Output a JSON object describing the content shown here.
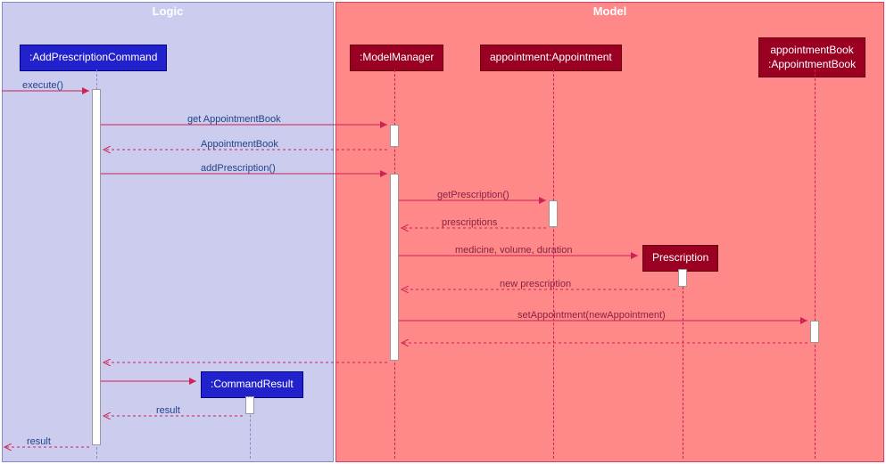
{
  "frames": {
    "logic": {
      "title": "Logic"
    },
    "model": {
      "title": "Model"
    }
  },
  "lifelines": {
    "addCmd": ":AddPrescriptionCommand",
    "modelMgr": ":ModelManager",
    "appointment": "appointment:Appointment",
    "apptBook": "appointmentBook\n:AppointmentBook",
    "prescription": "Prescription",
    "cmdResult": ":CommandResult"
  },
  "messages": {
    "execute": "execute()",
    "getApptBook": "get AppointmentBook",
    "apptBookRet": "AppointmentBook",
    "addPrescription": "addPrescription()",
    "getPrescription": "getPrescription()",
    "prescriptions": "prescriptions",
    "medVolDur": "medicine, volume, duration",
    "newPrescription": "new prescription",
    "setAppt": "setAppointment(newAppointment)",
    "resultInner": "result",
    "resultOuter": "result"
  },
  "chart_data": {
    "type": "sequence_diagram",
    "frames": [
      {
        "name": "Logic",
        "participants": [
          "AddPrescriptionCommand",
          "CommandResult"
        ]
      },
      {
        "name": "Model",
        "participants": [
          "ModelManager",
          "appointment:Appointment",
          "Prescription",
          "appointmentBook:AppointmentBook"
        ]
      }
    ],
    "participants": [
      {
        "id": "caller",
        "name": "(external)",
        "frame": null
      },
      {
        "id": "addCmd",
        "name": ":AddPrescriptionCommand",
        "frame": "Logic"
      },
      {
        "id": "modelMgr",
        "name": ":ModelManager",
        "frame": "Model"
      },
      {
        "id": "appointment",
        "name": "appointment:Appointment",
        "frame": "Model"
      },
      {
        "id": "prescription",
        "name": "Prescription",
        "frame": "Model",
        "created": true
      },
      {
        "id": "apptBook",
        "name": "appointmentBook:AppointmentBook",
        "frame": "Model"
      },
      {
        "id": "cmdResult",
        "name": ":CommandResult",
        "frame": "Logic",
        "created": true
      }
    ],
    "messages": [
      {
        "from": "caller",
        "to": "addCmd",
        "label": "execute()",
        "type": "sync"
      },
      {
        "from": "addCmd",
        "to": "modelMgr",
        "label": "get AppointmentBook",
        "type": "sync"
      },
      {
        "from": "modelMgr",
        "to": "addCmd",
        "label": "AppointmentBook",
        "type": "return"
      },
      {
        "from": "addCmd",
        "to": "modelMgr",
        "label": "addPrescription()",
        "type": "sync"
      },
      {
        "from": "modelMgr",
        "to": "appointment",
        "label": "getPrescription()",
        "type": "sync"
      },
      {
        "from": "appointment",
        "to": "modelMgr",
        "label": "prescriptions",
        "type": "return"
      },
      {
        "from": "modelMgr",
        "to": "prescription",
        "label": "medicine, volume, duration",
        "type": "create"
      },
      {
        "from": "prescription",
        "to": "modelMgr",
        "label": "new prescription",
        "type": "return"
      },
      {
        "from": "modelMgr",
        "to": "apptBook",
        "label": "setAppointment(newAppointment)",
        "type": "sync"
      },
      {
        "from": "apptBook",
        "to": "modelMgr",
        "label": "",
        "type": "return"
      },
      {
        "from": "modelMgr",
        "to": "addCmd",
        "label": "",
        "type": "return"
      },
      {
        "from": "addCmd",
        "to": "cmdResult",
        "label": "",
        "type": "create"
      },
      {
        "from": "cmdResult",
        "to": "addCmd",
        "label": "result",
        "type": "return"
      },
      {
        "from": "addCmd",
        "to": "caller",
        "label": "result",
        "type": "return"
      }
    ]
  }
}
